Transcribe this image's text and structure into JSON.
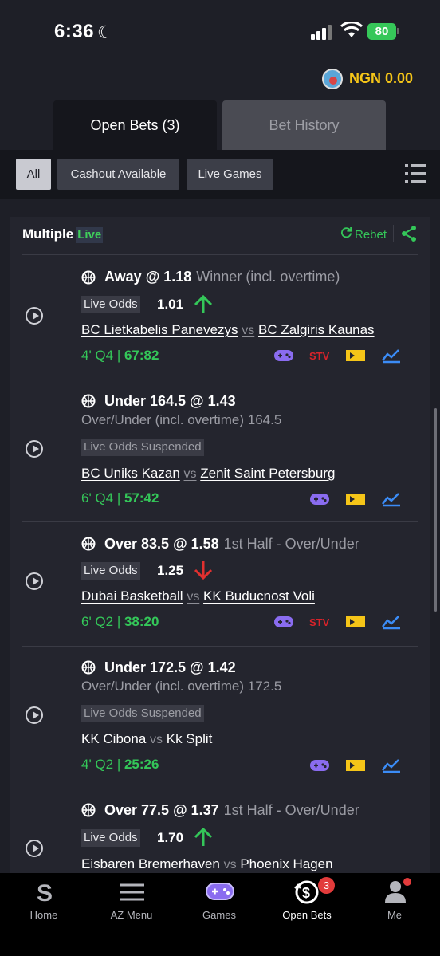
{
  "status": {
    "time": "6:36",
    "battery": "80"
  },
  "balance": {
    "text": "NGN 0.00"
  },
  "tabs": {
    "open": "Open Bets (3)",
    "history": "Bet History"
  },
  "filters": {
    "all": "All",
    "cashout": "Cashout Available",
    "live": "Live Games"
  },
  "card": {
    "title": "Multiple",
    "live": "Live",
    "rebet": "Rebet"
  },
  "selections": [
    {
      "pick": "Away @ 1.18",
      "market": "Winner (incl. overtime)",
      "odds_label": "Live Odds",
      "odds": "1.01",
      "trend": "up",
      "home": "BC Lietkabelis Panevezys",
      "vs": "vs",
      "away": "BC Zalgiris Kaunas",
      "time": "4' Q4 | ",
      "score": "67:82"
    },
    {
      "pick": "Under 164.5 @ 1.43",
      "market": "Over/Under (incl. overtime) 164.5",
      "odds_label": "Live Odds Suspended",
      "home": "BC Uniks Kazan",
      "vs": "vs",
      "away": "Zenit Saint Petersburg",
      "time": "6' Q4 | ",
      "score": "57:42"
    },
    {
      "pick": "Over 83.5 @ 1.58",
      "market": "1st Half  -  Over/Under",
      "odds_label": "Live Odds",
      "odds": "1.25",
      "trend": "down",
      "home": "Dubai Basketball",
      "vs": "vs",
      "away": "KK Buducnost Voli",
      "time": "6' Q2 | ",
      "score": "38:20"
    },
    {
      "pick": "Under 172.5 @ 1.42",
      "market": "Over/Under (incl. overtime) 172.5",
      "odds_label": "Live Odds Suspended",
      "home": "KK Cibona",
      "vs": "vs",
      "away": "Kk Split",
      "time": "4' Q2 | ",
      "score": "25:26"
    },
    {
      "pick": "Over 77.5 @ 1.37",
      "market": "1st Half  -  Over/Under",
      "odds_label": "Live Odds",
      "odds": "1.70",
      "trend": "up",
      "home": "Eisbaren Bremerhaven",
      "vs": "vs",
      "away": "Phoenix Hagen"
    }
  ],
  "nav": [
    {
      "label": "Home"
    },
    {
      "label": "AZ Menu"
    },
    {
      "label": "Games"
    },
    {
      "label": "Open Bets",
      "badge": "3"
    },
    {
      "label": "Me"
    }
  ],
  "colors": {
    "accent_green": "#34c759",
    "balance_yellow": "#f5c518",
    "down_red": "#e0302f",
    "badge_red": "#e23b3b"
  }
}
